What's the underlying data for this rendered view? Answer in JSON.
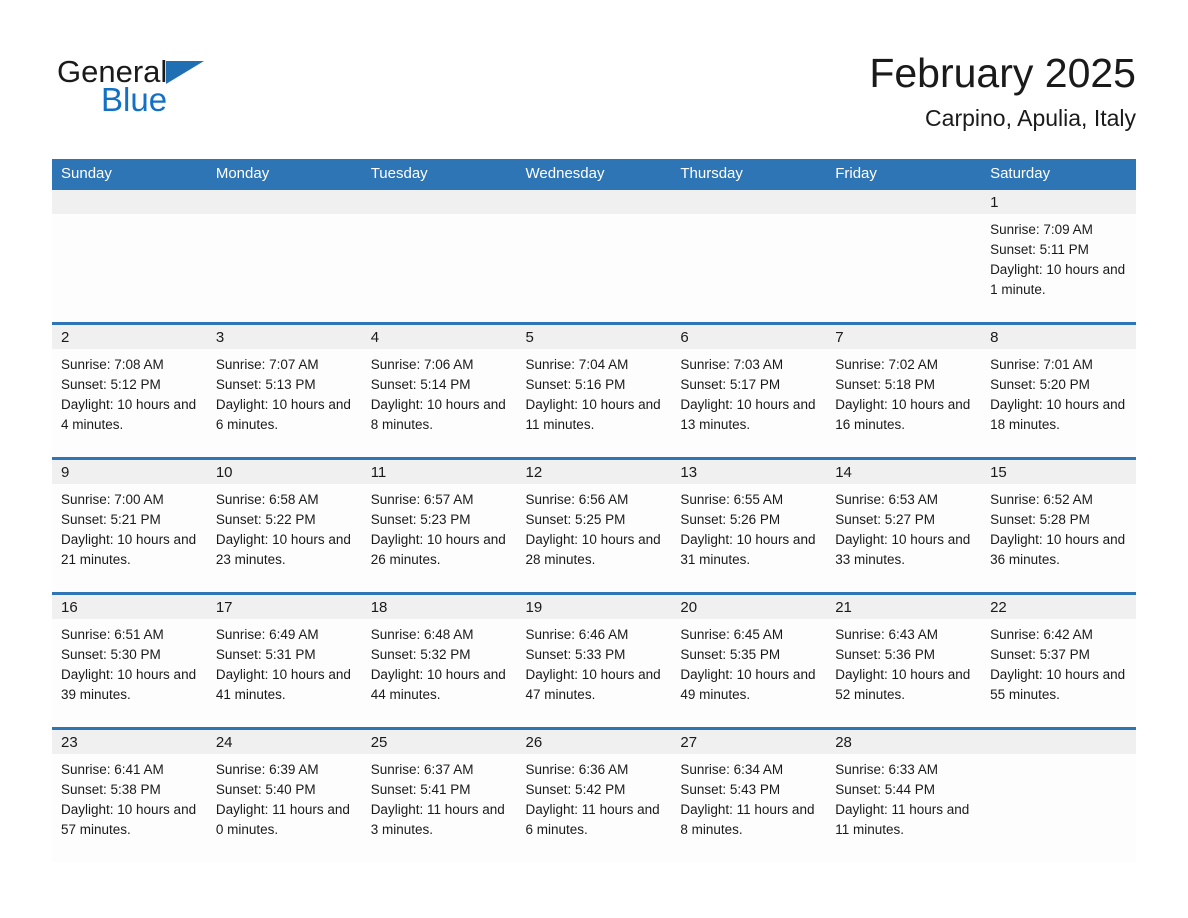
{
  "brand": {
    "name_part1": "General",
    "name_part2": "Blue",
    "logo_color": "#1f6fb2"
  },
  "header": {
    "month_year": "February 2025",
    "location": "Carpino, Apulia, Italy"
  },
  "theme": {
    "header_blue": "#2e75b6",
    "daynum_band": "#f0f0f0",
    "cell_background": "#fdfdfd",
    "text": "#1a1a1a"
  },
  "weekday_headers": [
    "Sunday",
    "Monday",
    "Tuesday",
    "Wednesday",
    "Thursday",
    "Friday",
    "Saturday"
  ],
  "labels": {
    "sunrise_prefix": "Sunrise:",
    "sunset_prefix": "Sunset:",
    "daylight_prefix": "Daylight:"
  },
  "weeks": [
    [
      {
        "day": "",
        "empty": true
      },
      {
        "day": "",
        "empty": true
      },
      {
        "day": "",
        "empty": true
      },
      {
        "day": "",
        "empty": true
      },
      {
        "day": "",
        "empty": true
      },
      {
        "day": "",
        "empty": true
      },
      {
        "day": "1",
        "sunrise": "Sunrise: 7:09 AM",
        "sunset": "Sunset: 5:11 PM",
        "daylight": "Daylight: 10 hours and 1 minute."
      }
    ],
    [
      {
        "day": "2",
        "sunrise": "Sunrise: 7:08 AM",
        "sunset": "Sunset: 5:12 PM",
        "daylight": "Daylight: 10 hours and 4 minutes."
      },
      {
        "day": "3",
        "sunrise": "Sunrise: 7:07 AM",
        "sunset": "Sunset: 5:13 PM",
        "daylight": "Daylight: 10 hours and 6 minutes."
      },
      {
        "day": "4",
        "sunrise": "Sunrise: 7:06 AM",
        "sunset": "Sunset: 5:14 PM",
        "daylight": "Daylight: 10 hours and 8 minutes."
      },
      {
        "day": "5",
        "sunrise": "Sunrise: 7:04 AM",
        "sunset": "Sunset: 5:16 PM",
        "daylight": "Daylight: 10 hours and 11 minutes."
      },
      {
        "day": "6",
        "sunrise": "Sunrise: 7:03 AM",
        "sunset": "Sunset: 5:17 PM",
        "daylight": "Daylight: 10 hours and 13 minutes."
      },
      {
        "day": "7",
        "sunrise": "Sunrise: 7:02 AM",
        "sunset": "Sunset: 5:18 PM",
        "daylight": "Daylight: 10 hours and 16 minutes."
      },
      {
        "day": "8",
        "sunrise": "Sunrise: 7:01 AM",
        "sunset": "Sunset: 5:20 PM",
        "daylight": "Daylight: 10 hours and 18 minutes."
      }
    ],
    [
      {
        "day": "9",
        "sunrise": "Sunrise: 7:00 AM",
        "sunset": "Sunset: 5:21 PM",
        "daylight": "Daylight: 10 hours and 21 minutes."
      },
      {
        "day": "10",
        "sunrise": "Sunrise: 6:58 AM",
        "sunset": "Sunset: 5:22 PM",
        "daylight": "Daylight: 10 hours and 23 minutes."
      },
      {
        "day": "11",
        "sunrise": "Sunrise: 6:57 AM",
        "sunset": "Sunset: 5:23 PM",
        "daylight": "Daylight: 10 hours and 26 minutes."
      },
      {
        "day": "12",
        "sunrise": "Sunrise: 6:56 AM",
        "sunset": "Sunset: 5:25 PM",
        "daylight": "Daylight: 10 hours and 28 minutes."
      },
      {
        "day": "13",
        "sunrise": "Sunrise: 6:55 AM",
        "sunset": "Sunset: 5:26 PM",
        "daylight": "Daylight: 10 hours and 31 minutes."
      },
      {
        "day": "14",
        "sunrise": "Sunrise: 6:53 AM",
        "sunset": "Sunset: 5:27 PM",
        "daylight": "Daylight: 10 hours and 33 minutes."
      },
      {
        "day": "15",
        "sunrise": "Sunrise: 6:52 AM",
        "sunset": "Sunset: 5:28 PM",
        "daylight": "Daylight: 10 hours and 36 minutes."
      }
    ],
    [
      {
        "day": "16",
        "sunrise": "Sunrise: 6:51 AM",
        "sunset": "Sunset: 5:30 PM",
        "daylight": "Daylight: 10 hours and 39 minutes."
      },
      {
        "day": "17",
        "sunrise": "Sunrise: 6:49 AM",
        "sunset": "Sunset: 5:31 PM",
        "daylight": "Daylight: 10 hours and 41 minutes."
      },
      {
        "day": "18",
        "sunrise": "Sunrise: 6:48 AM",
        "sunset": "Sunset: 5:32 PM",
        "daylight": "Daylight: 10 hours and 44 minutes."
      },
      {
        "day": "19",
        "sunrise": "Sunrise: 6:46 AM",
        "sunset": "Sunset: 5:33 PM",
        "daylight": "Daylight: 10 hours and 47 minutes."
      },
      {
        "day": "20",
        "sunrise": "Sunrise: 6:45 AM",
        "sunset": "Sunset: 5:35 PM",
        "daylight": "Daylight: 10 hours and 49 minutes."
      },
      {
        "day": "21",
        "sunrise": "Sunrise: 6:43 AM",
        "sunset": "Sunset: 5:36 PM",
        "daylight": "Daylight: 10 hours and 52 minutes."
      },
      {
        "day": "22",
        "sunrise": "Sunrise: 6:42 AM",
        "sunset": "Sunset: 5:37 PM",
        "daylight": "Daylight: 10 hours and 55 minutes."
      }
    ],
    [
      {
        "day": "23",
        "sunrise": "Sunrise: 6:41 AM",
        "sunset": "Sunset: 5:38 PM",
        "daylight": "Daylight: 10 hours and 57 minutes."
      },
      {
        "day": "24",
        "sunrise": "Sunrise: 6:39 AM",
        "sunset": "Sunset: 5:40 PM",
        "daylight": "Daylight: 11 hours and 0 minutes."
      },
      {
        "day": "25",
        "sunrise": "Sunrise: 6:37 AM",
        "sunset": "Sunset: 5:41 PM",
        "daylight": "Daylight: 11 hours and 3 minutes."
      },
      {
        "day": "26",
        "sunrise": "Sunrise: 6:36 AM",
        "sunset": "Sunset: 5:42 PM",
        "daylight": "Daylight: 11 hours and 6 minutes."
      },
      {
        "day": "27",
        "sunrise": "Sunrise: 6:34 AM",
        "sunset": "Sunset: 5:43 PM",
        "daylight": "Daylight: 11 hours and 8 minutes."
      },
      {
        "day": "28",
        "sunrise": "Sunrise: 6:33 AM",
        "sunset": "Sunset: 5:44 PM",
        "daylight": "Daylight: 11 hours and 11 minutes."
      },
      {
        "day": "",
        "empty": true
      }
    ]
  ]
}
